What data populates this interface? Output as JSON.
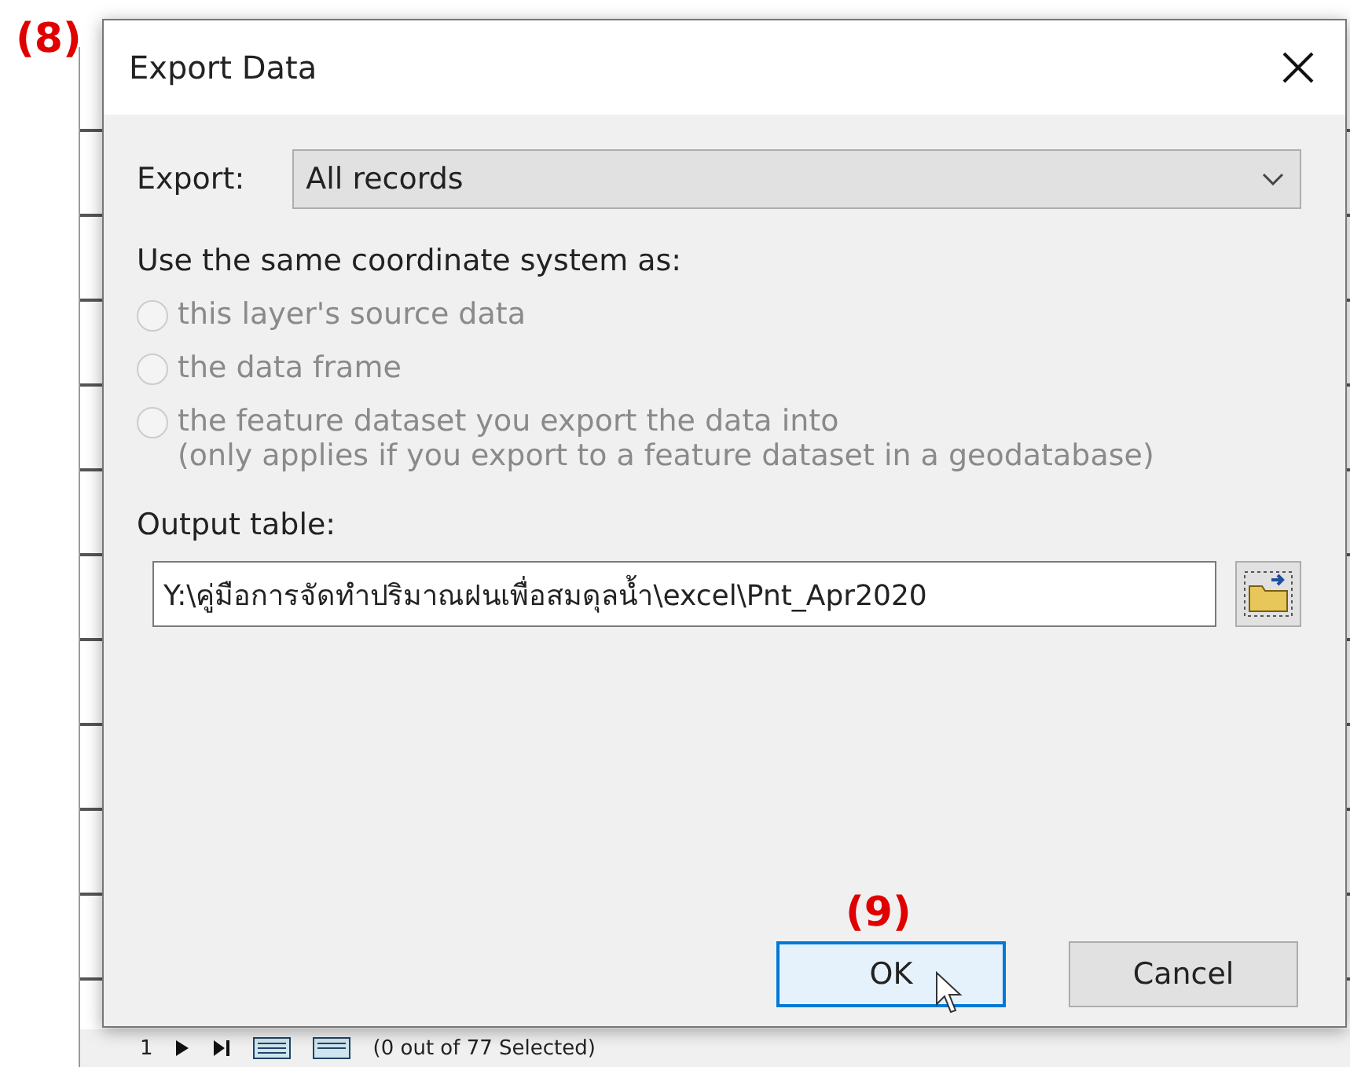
{
  "background_window": {
    "record_navigator": {
      "current": "1",
      "selection_status": "(0 out of 77 Selected)"
    }
  },
  "annotations": [
    {
      "label": "(8)"
    },
    {
      "label": "(9)"
    }
  ],
  "dialog": {
    "title": "Export Data",
    "export": {
      "label": "Export:",
      "value": "All records"
    },
    "coordinate_system": {
      "heading": "Use the same coordinate system as:",
      "options": [
        {
          "label": "this layer's source data",
          "selected": false,
          "disabled": true
        },
        {
          "label": "the data frame",
          "selected": false,
          "disabled": true
        },
        {
          "label": "the feature dataset you export the data into",
          "note": "(only applies if you export to a feature dataset in a geodatabase)",
          "selected": false,
          "disabled": true
        }
      ]
    },
    "output": {
      "label": "Output table:",
      "value": "Y:\\คู่มือการจัดทำปริมาณฝนเพื่อสมดุลน้ำ\\excel\\Pnt_Apr2020"
    },
    "buttons": [
      {
        "label": "OK",
        "focused": true
      },
      {
        "label": "Cancel",
        "focused": false
      }
    ]
  }
}
